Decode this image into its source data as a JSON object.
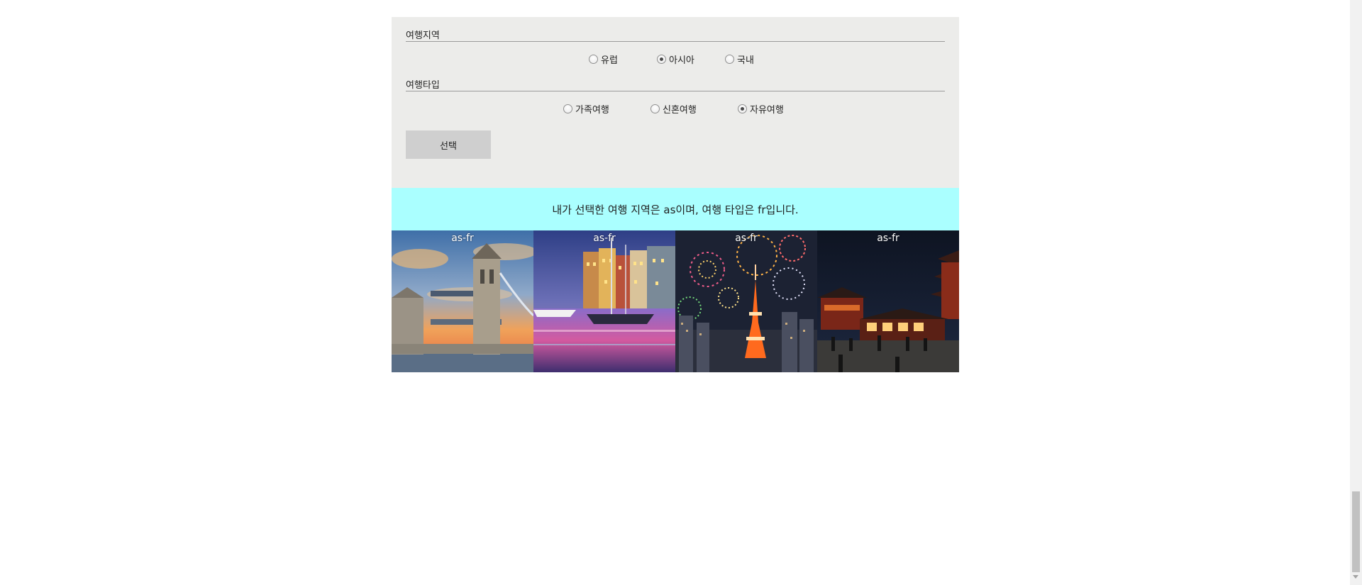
{
  "form": {
    "region": {
      "legend": "여행지역",
      "options": [
        {
          "label": "유럽",
          "checked": false
        },
        {
          "label": "아시아",
          "checked": true
        },
        {
          "label": "국내",
          "checked": false
        }
      ]
    },
    "type": {
      "legend": "여행타입",
      "options": [
        {
          "label": "가족여행",
          "checked": false
        },
        {
          "label": "신혼여행",
          "checked": false
        },
        {
          "label": "자유여행",
          "checked": true
        }
      ]
    },
    "submit_label": "선택"
  },
  "result": {
    "message": "내가 선택한 여행 지역은 as이며, 여행 타입은 fr입니다."
  },
  "gallery": {
    "tiles": [
      {
        "caption": "as-fr",
        "image": "tower-bridge-photo"
      },
      {
        "caption": "as-fr",
        "image": "harbor-boats-photo"
      },
      {
        "caption": "as-fr",
        "image": "tokyo-tower-fireworks-photo"
      },
      {
        "caption": "as-fr",
        "image": "temple-night-photo"
      }
    ]
  },
  "colors": {
    "panel_bg": "#ececea",
    "result_bg": "#aaffff",
    "button_bg": "#cfcfcf"
  }
}
